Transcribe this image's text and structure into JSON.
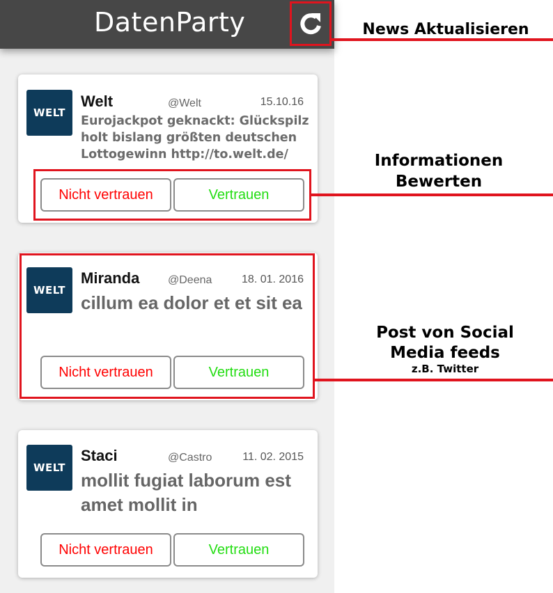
{
  "app": {
    "title": "DatenParty"
  },
  "refresh": {
    "icon": "refresh-icon"
  },
  "posts": [
    {
      "logo": "WELT",
      "author": "Welt",
      "handle": "@Welt",
      "date": "15.10.16",
      "text": "Eurojackpot geknackt: Glückspilz holt bislang größten deutschen Lottogewinn http://to.welt.de/",
      "distrust_label": "Nicht vertrauen",
      "trust_label": "Vertrauen"
    },
    {
      "logo": "WELT",
      "author": "Miranda",
      "handle": "@Deena",
      "date": "18. 01. 2016",
      "text": "cillum ea dolor et et sit ea",
      "distrust_label": "Nicht vertrauen",
      "trust_label": "Vertrauen"
    },
    {
      "logo": "WELT",
      "author": "Staci",
      "handle": "@Castro",
      "date": "11. 02. 2015",
      "text": "mollit fugiat laborum est amet mollit in",
      "distrust_label": "Nicht vertrauen",
      "trust_label": "Vertrauen"
    }
  ],
  "annotations": {
    "refresh": "News Aktualisieren",
    "rate_line1": "Informationen",
    "rate_line2": "Bewerten",
    "post_line1": "Post von Social",
    "post_line2": "Media feeds",
    "post_line3": "z.B. Twitter"
  },
  "colors": {
    "topbar": "#474747",
    "highlight": "#e0141e",
    "logo_bg": "#0e3b5a",
    "distrust": "#ff0000",
    "trust": "#22dd11"
  }
}
